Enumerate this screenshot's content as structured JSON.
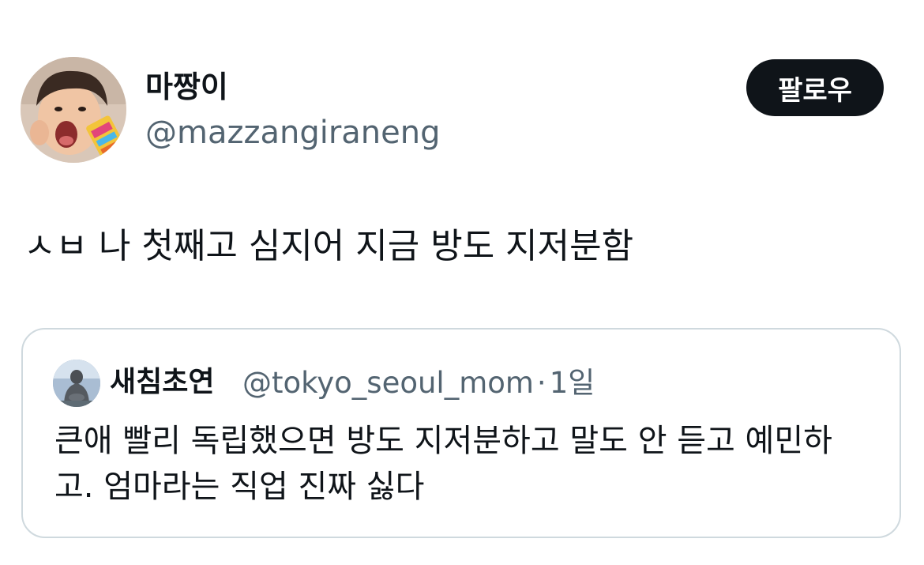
{
  "author": {
    "display_name": "마짱이",
    "handle": "@mazzangiraneng"
  },
  "follow_button": {
    "label": "팔로우"
  },
  "tweet": {
    "text": "ㅅㅂ 나 첫째고 심지어 지금 방도 지저분함"
  },
  "quoted_tweet": {
    "display_name": "새침초연",
    "handle": "@tokyo_seoul_mom",
    "separator": "·",
    "time": "1일",
    "text_line_1": "큰애 빨리 독립했으면 방도 지저분하고 말도 안 듣고 예민하",
    "text_line_2": "고. 엄마라는 직업 진짜 싫다"
  },
  "colors": {
    "text_primary": "#0f1419",
    "text_secondary": "#536471",
    "button_bg": "#0f1419",
    "button_text": "#ffffff",
    "card_border": "#cfd9de"
  },
  "icons": {
    "avatar": "profile-photo-child",
    "quote_avatar": "profile-photo-statue"
  }
}
